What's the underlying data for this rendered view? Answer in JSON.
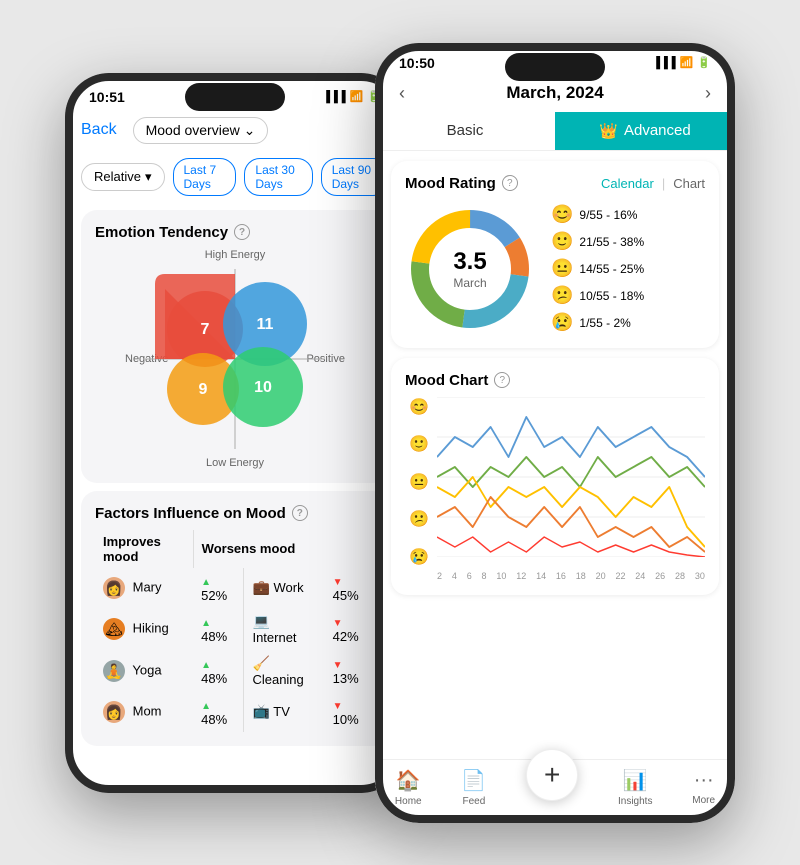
{
  "leftPhone": {
    "time": "10:51",
    "header": {
      "back": "Back",
      "dropdown": "Mood overview ⌄"
    },
    "filter": {
      "relative": "Relative",
      "options": [
        "Last 7 Days",
        "Last 30 Days",
        "Last 90 Days"
      ]
    },
    "emotionCard": {
      "title": "Emotion Tendency",
      "labels": {
        "top": "High Energy",
        "bottom": "Low Energy",
        "left": "Negative",
        "right": "Positive"
      },
      "quadrants": {
        "topLeft": 7,
        "topRight": 11,
        "bottomLeft": 9,
        "bottomRight": 10
      }
    },
    "factorsCard": {
      "title": "Factors Influence on Mood",
      "improves": "Improves mood",
      "worsens": "Worsens mood",
      "improvesItems": [
        {
          "name": "Mary",
          "pct": "52%",
          "color": "#e8a87c"
        },
        {
          "name": "Hiking",
          "pct": "48%",
          "color": "#e67e22"
        },
        {
          "name": "Yoga",
          "pct": "48%",
          "color": "#95a5a6"
        },
        {
          "name": "Mom",
          "pct": "48%",
          "color": "#e8a87c"
        }
      ],
      "worsensItems": [
        {
          "name": "Work",
          "pct": "45%"
        },
        {
          "name": "Internet",
          "pct": "42%"
        },
        {
          "name": "Cleaning",
          "pct": "13%"
        },
        {
          "name": "TV",
          "pct": "10%"
        }
      ]
    }
  },
  "rightPhone": {
    "time": "10:50",
    "nav": {
      "title": "March, 2024",
      "prev": "‹",
      "next": "›"
    },
    "tabs": {
      "basic": "Basic",
      "advanced": "Advanced",
      "crownIcon": "👑"
    },
    "moodRating": {
      "title": "Mood Rating",
      "calendarLink": "Calendar",
      "chartLink": "Chart",
      "donutValue": "3.5",
      "donutLabel": "March",
      "legend": [
        {
          "emoji": "😊",
          "label": "9/55 - 16%"
        },
        {
          "emoji": "🙂",
          "label": "21/55 - 38%"
        },
        {
          "emoji": "😐",
          "label": "14/55 - 25%"
        },
        {
          "emoji": "😕",
          "label": "10/55 - 18%"
        },
        {
          "emoji": "😢",
          "label": "1/55 - 2%"
        }
      ],
      "donutSegments": [
        {
          "color": "#5B9BD5",
          "pct": 16
        },
        {
          "color": "#ED7D31",
          "pct": 11
        },
        {
          "color": "#4BACC6",
          "pct": 25
        },
        {
          "color": "#70AD47",
          "pct": 25
        },
        {
          "color": "#FFC000",
          "pct": 23
        }
      ]
    },
    "moodChart": {
      "title": "Mood Chart",
      "emojis": [
        "😊",
        "🙂",
        "😐",
        "😕",
        "😢"
      ],
      "xLabels": [
        "2",
        "4",
        "6",
        "8",
        "10",
        "12",
        "14",
        "16",
        "18",
        "20",
        "22",
        "24",
        "26",
        "28",
        "30"
      ]
    },
    "bottomNav": [
      {
        "icon": "🏠",
        "label": "Home"
      },
      {
        "icon": "📄",
        "label": "Feed"
      },
      {
        "icon": "+",
        "label": ""
      },
      {
        "icon": "📊",
        "label": "Insights"
      },
      {
        "icon": "···",
        "label": "More"
      }
    ]
  }
}
